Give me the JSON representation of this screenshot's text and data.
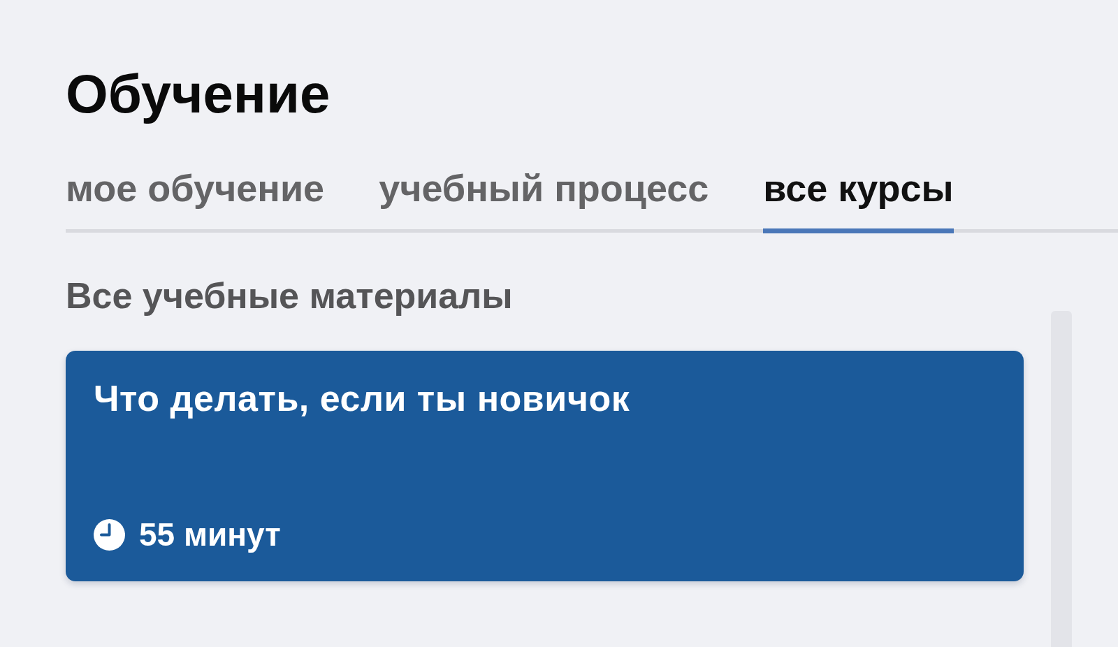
{
  "page": {
    "title": "Обучение"
  },
  "tabs": [
    {
      "label": "мое обучение",
      "selected": false
    },
    {
      "label": "учебный процесс",
      "selected": false
    },
    {
      "label": "все курсы",
      "selected": true
    }
  ],
  "section": {
    "title": "Все учебные материалы",
    "courses": [
      {
        "title": "Что делать, если ты новичок",
        "duration": "55 минут"
      }
    ]
  }
}
